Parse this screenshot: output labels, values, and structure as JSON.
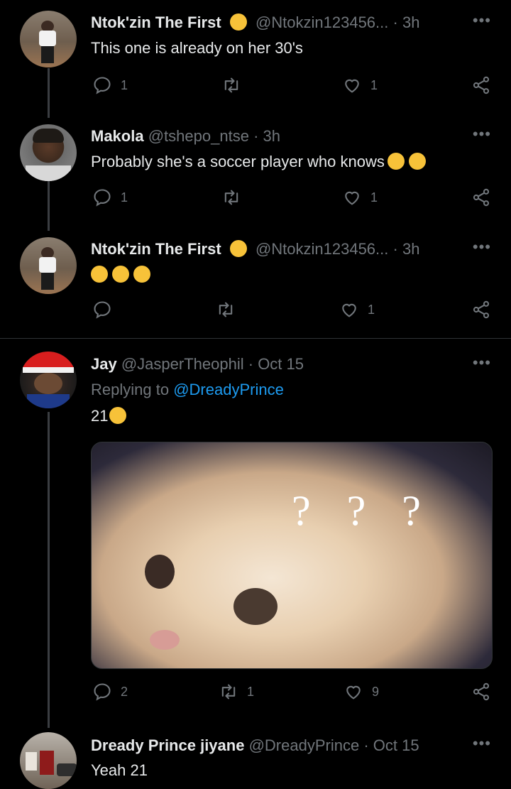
{
  "tweets": [
    {
      "name": "Ntok'zin The First",
      "handle": "@Ntokzin123456...",
      "time": "3h",
      "text": "This one is already on her 30's",
      "replies": "1",
      "retweets": "",
      "likes": "1"
    },
    {
      "name": "Makola",
      "handle": "@tshepo_ntse",
      "time": "3h",
      "text": "Probably she's a soccer player who knows",
      "replies": "1",
      "retweets": "",
      "likes": "1"
    },
    {
      "name": "Ntok'zin The First",
      "handle": "@Ntokzin123456...",
      "time": "3h",
      "text": "",
      "replies": "",
      "retweets": "",
      "likes": "1"
    },
    {
      "name": "Jay",
      "handle": "@JasperTheophil",
      "time": "Oct 15",
      "replying_prefix": "Replying to",
      "replying_to": "@DreadyPrince",
      "text": "21",
      "replies": "2",
      "retweets": "1",
      "likes": "9"
    },
    {
      "name": "Dready Prince jiyane",
      "handle": "@DreadyPrince",
      "time": "Oct 15",
      "text": "Yeah 21"
    }
  ],
  "separator": "·",
  "media": {
    "overlay_text": "? ? ?"
  },
  "colors": {
    "background": "#000000",
    "text": "#e7e9ea",
    "muted": "#71767b",
    "link": "#1d9bf0",
    "divider": "#2f3336"
  },
  "icons": [
    "reply-icon",
    "retweet-icon",
    "like-icon",
    "share-icon",
    "more-icon"
  ]
}
